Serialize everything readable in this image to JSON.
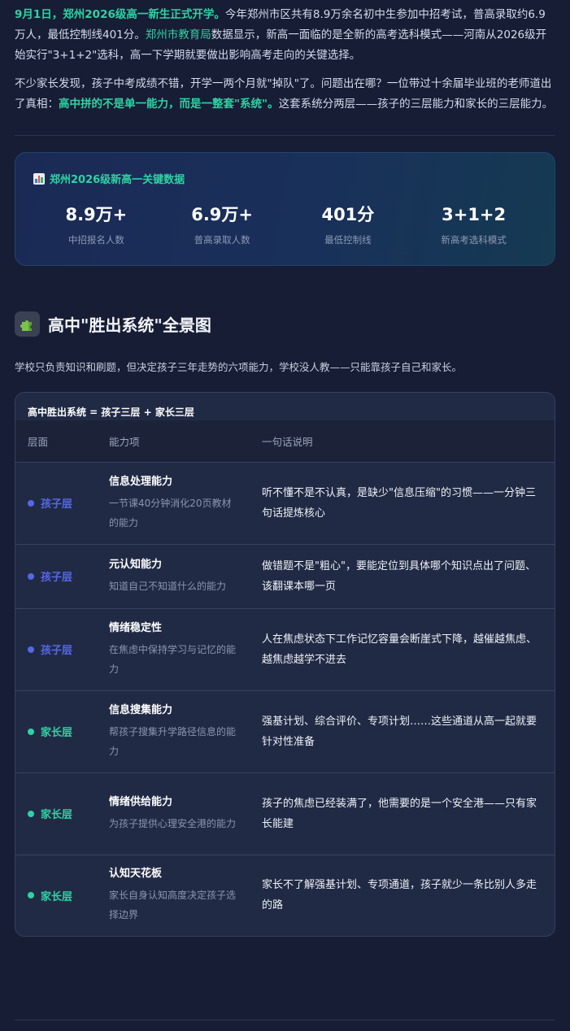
{
  "intro": {
    "p1_lead": "9月1日，郑州2026级高一新生正式开学。",
    "p1_text_a": "今年郑州市区共有8.9万余名初中生参加中招考试，普高录取约6.9万人，最低控制线401分。",
    "p1_link": "郑州市教育局",
    "p1_text_b": "数据显示，新高一面临的是全新的高考选科模式——河南从2026级开始实行\"3+1+2\"选科，高一下学期就要做出影响高考走向的关键选择。",
    "p2_text_a": "不少家长发现，孩子中考成绩不错，开学一两个月就\"掉队\"了。问题出在哪？一位带过十余届毕业班的老师道出了真相：",
    "p2_highlight": "高中拼的不是单一能力，而是一整套\"系统\"。",
    "p2_text_b": "这套系统分两层——孩子的三层能力和家长的三层能力。"
  },
  "stats": {
    "title": "郑州2026级新高一关键数据",
    "icon": "bar-chart-icon",
    "items": [
      {
        "value": "8.9万+",
        "label": "中招报名人数"
      },
      {
        "value": "6.9万+",
        "label": "普高录取人数"
      },
      {
        "value": "401分",
        "label": "最低控制线"
      },
      {
        "value": "3+1+2",
        "label": "新高考选科模式"
      }
    ]
  },
  "section": {
    "icon": "puzzle-icon",
    "title": "高中\"胜出系统\"全景图",
    "desc": "学校只负责知识和刷题，但决定孩子三年走势的六项能力，学校没人教——只能靠孩子自己和家长。"
  },
  "table": {
    "caption": "高中胜出系统 = 孩子三层 + 家长三层",
    "headers": [
      "层面",
      "能力项",
      "一句话说明"
    ],
    "colors": {
      "child": "#5468e6",
      "parent": "#2ed3a3"
    },
    "rows": [
      {
        "layer": "孩子层",
        "name": "信息处理能力",
        "sub": "一节课40分钟消化20页教材的能力",
        "explain": "听不懂不是不认真，是缺少\"信息压缩\"的习惯——一分钟三句话提炼核心"
      },
      {
        "layer": "孩子层",
        "name": "元认知能力",
        "sub": "知道自己不知道什么的能力",
        "explain": "做错题不是\"粗心\"，要能定位到具体哪个知识点出了问题、该翻课本哪一页"
      },
      {
        "layer": "孩子层",
        "name": "情绪稳定性",
        "sub": "在焦虑中保持学习与记忆的能力",
        "explain": "人在焦虑状态下工作记忆容量会断崖式下降，越催越焦虑、越焦虑越学不进去"
      },
      {
        "layer": "家长层",
        "name": "信息搜集能力",
        "sub": "帮孩子搜集升学路径信息的能力",
        "explain": "强基计划、综合评价、专项计划……这些通道从高一起就要针对性准备"
      },
      {
        "layer": "家长层",
        "name": "情绪供给能力",
        "sub": "为孩子提供心理安全港的能力",
        "explain": "孩子的焦虑已经装满了，他需要的是一个安全港——只有家长能建"
      },
      {
        "layer": "家长层",
        "name": "认知天花板",
        "sub": "家长自身认知高度决定孩子选择边界",
        "explain": "家长不了解强基计划、专项通道，孩子就少一条比别人多走的路"
      }
    ]
  }
}
